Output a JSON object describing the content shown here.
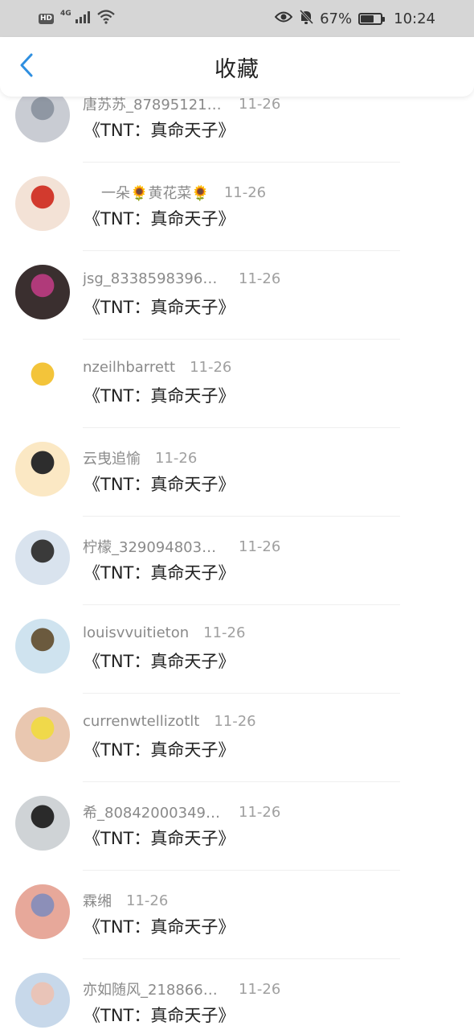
{
  "status_bar": {
    "hd": "HD",
    "network": "4G",
    "battery": "67%",
    "battery_level": 0.67,
    "time": "10:24",
    "icons": [
      "signal-icon",
      "wifi-icon",
      "eye-icon",
      "mute-bell-icon",
      "battery-icon"
    ]
  },
  "header": {
    "title": "收藏",
    "back_icon": "chevron-left-icon",
    "accent": "#2f8fe0"
  },
  "items": [
    {
      "name": "唐苏苏_87895121…",
      "date": "11-26",
      "content": "《TNT：真命天子》",
      "avatar_colors": [
        "#c9ccd3",
        "#8f97a3"
      ]
    },
    {
      "name": "一朵🌻黄花菜🌻",
      "date": "11-26",
      "content": "《TNT：真命天子》",
      "avatar_colors": [
        "#f3e2d6",
        "#d23a2e"
      ]
    },
    {
      "name": "jsg_83385983961…",
      "date": "11-26",
      "content": "《TNT：真命天子》",
      "avatar_colors": [
        "#3a2f2f",
        "#b03a7a"
      ]
    },
    {
      "name": "nzeilhbarrett",
      "date": "11-26",
      "content": "《TNT：真命天子》",
      "avatar_colors": [
        "#ffffff",
        "#f3c43a"
      ]
    },
    {
      "name": "云曳追愉",
      "date": "11-26",
      "content": "《TNT：真命天子》",
      "avatar_colors": [
        "#fbe8c4",
        "#2d2d2d"
      ]
    },
    {
      "name": "柠檬_3290948036…",
      "date": "11-26",
      "content": "《TNT：真命天子》",
      "avatar_colors": [
        "#d9e3ee",
        "#3a3a3a"
      ]
    },
    {
      "name": "louisvvuitieton",
      "date": "11-26",
      "content": "《TNT：真命天子》",
      "avatar_colors": [
        "#cfe3ef",
        "#6b5a3e"
      ]
    },
    {
      "name": "currenwtellizotlt",
      "date": "11-26",
      "content": "《TNT：真命天子》",
      "avatar_colors": [
        "#e9c7b0",
        "#f0d94a"
      ]
    },
    {
      "name": "希_808420003493…",
      "date": "11-26",
      "content": "《TNT：真命天子》",
      "avatar_colors": [
        "#cfd3d6",
        "#2a2a2a"
      ]
    },
    {
      "name": "霖缃",
      "date": "11-26",
      "content": "《TNT：真命天子》",
      "avatar_colors": [
        "#e7a89a",
        "#8c8fb8"
      ]
    },
    {
      "name": "亦如随风_218866…",
      "date": "11-26",
      "content": "《TNT：真命天子》",
      "avatar_colors": [
        "#c7d8ea",
        "#e9c4b8"
      ]
    }
  ]
}
